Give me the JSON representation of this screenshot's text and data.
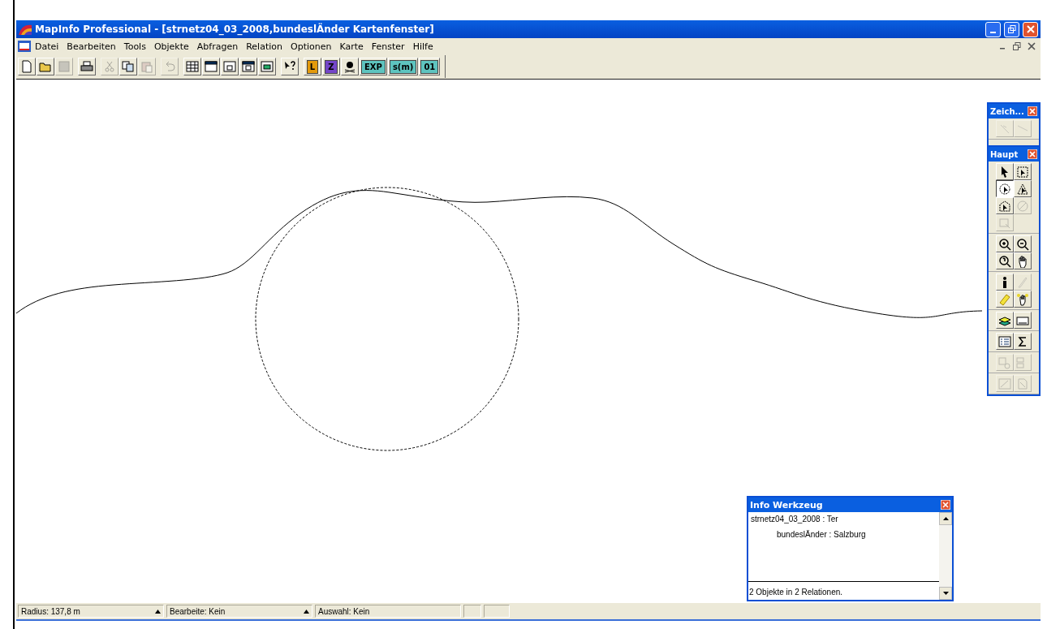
{
  "window": {
    "title": "MapInfo Professional - [strnetz04_03_2008,bundeslÄnder Kartenfenster]"
  },
  "menu": [
    "Datei",
    "Bearbeiten",
    "Tools",
    "Objekte",
    "Abfragen",
    "Relation",
    "Optionen",
    "Karte",
    "Fenster",
    "Hilfe"
  ],
  "toolbar": {
    "groups": [
      {
        "items": [
          {
            "kind": "icon",
            "disabled": false
          },
          {
            "kind": "icon",
            "disabled": false
          },
          {
            "kind": "icon",
            "disabled": true
          }
        ]
      },
      {
        "items": [
          {
            "kind": "icon",
            "disabled": false
          }
        ]
      },
      {
        "items": [
          {
            "kind": "icon",
            "disabled": true
          },
          {
            "kind": "icon",
            "disabled": false
          },
          {
            "kind": "icon",
            "disabled": true
          }
        ]
      },
      {
        "items": [
          {
            "kind": "icon",
            "disabled": true
          }
        ]
      },
      {
        "items": [
          {
            "kind": "icon",
            "disabled": false
          },
          {
            "kind": "icon",
            "disabled": false
          },
          {
            "kind": "icon",
            "disabled": false
          },
          {
            "kind": "icon",
            "disabled": false
          },
          {
            "kind": "icon",
            "disabled": false
          }
        ]
      },
      {
        "items": [
          {
            "kind": "icon",
            "disabled": false
          }
        ]
      },
      {
        "items": [
          {
            "kind": "text",
            "label": "L",
            "color": "#e39a0c",
            "disabled": false
          },
          {
            "kind": "text",
            "label": "Z",
            "color": "#7446c8",
            "disabled": false
          },
          {
            "kind": "icon",
            "disabled": false
          },
          {
            "kind": "text",
            "label": "EXP",
            "color": "#5ec4bf",
            "disabled": false
          },
          {
            "kind": "text",
            "label": "s(m)",
            "color": "#5ec4bf",
            "disabled": false
          },
          {
            "kind": "text",
            "label": "01",
            "color": "#5ec4bf",
            "disabled": false
          }
        ]
      }
    ]
  },
  "palettes": [
    {
      "title": "Zeich...",
      "groups": [
        {
          "tools": [
            {
              "disabled": true,
              "selected": false
            },
            {
              "disabled": true,
              "selected": false
            }
          ]
        }
      ]
    },
    {
      "title": "Haupt",
      "groups": [
        {
          "tools": [
            {
              "disabled": false,
              "selected": false
            },
            {
              "disabled": false,
              "selected": false
            },
            {
              "disabled": false,
              "selected": true
            },
            {
              "disabled": false,
              "selected": false
            },
            {
              "disabled": false,
              "selected": false
            },
            {
              "disabled": true,
              "selected": false
            },
            {
              "disabled": true,
              "selected": false
            }
          ]
        },
        {
          "tools": [
            {
              "disabled": false,
              "selected": false
            },
            {
              "disabled": false,
              "selected": false
            },
            {
              "disabled": false,
              "selected": false
            },
            {
              "disabled": false,
              "selected": false
            }
          ]
        },
        {
          "tools": [
            {
              "disabled": false,
              "selected": false
            },
            {
              "disabled": true,
              "selected": false
            },
            {
              "disabled": false,
              "selected": false
            },
            {
              "disabled": false,
              "selected": false
            }
          ]
        },
        {
          "tools": [
            {
              "disabled": false,
              "selected": false
            },
            {
              "disabled": false,
              "selected": false
            }
          ]
        },
        {
          "tools": [
            {
              "disabled": false,
              "selected": false
            },
            {
              "disabled": false,
              "selected": false
            }
          ]
        },
        {
          "tools": [
            {
              "disabled": true,
              "selected": false
            },
            {
              "disabled": true,
              "selected": false
            }
          ]
        },
        {
          "tools": [
            {
              "disabled": true,
              "selected": false
            },
            {
              "disabled": true,
              "selected": false
            }
          ]
        }
      ]
    }
  ],
  "info_window": {
    "title": "Info Werkzeug",
    "lines": [
      {
        "text": "strnetz04_03_2008 : Ter",
        "children": [
          {
            "text": "bundeslÄnder : Salzburg"
          }
        ]
      }
    ],
    "footer": "2 Objekte in 2 Relationen."
  },
  "status_bar": [
    {
      "text": "Radius: 137,8 m",
      "has_menu": true
    },
    {
      "text": "Bearbeite: Kein",
      "has_menu": true
    },
    {
      "text": "Auswahl: Kein",
      "has_menu": false
    }
  ]
}
